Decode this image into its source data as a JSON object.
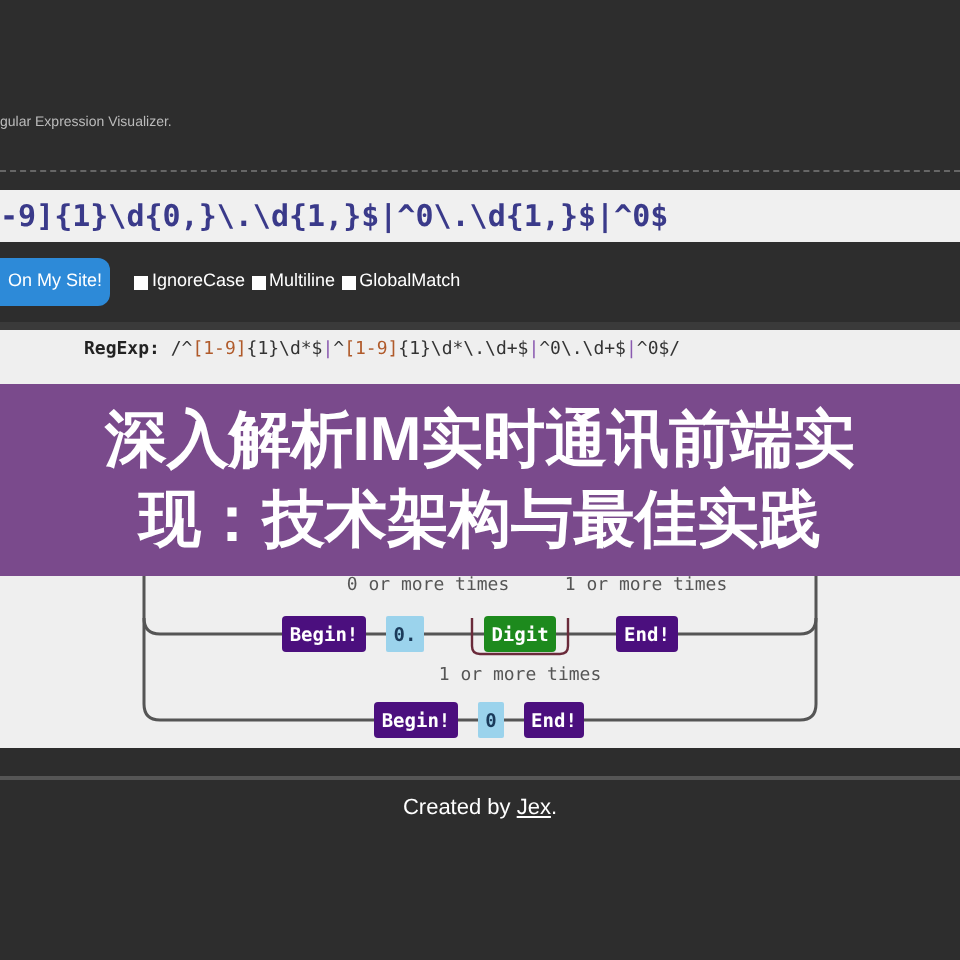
{
  "header": {
    "subtitle": "gular Expression Visualizer."
  },
  "input": {
    "value": "-9]{1}\\d{0,}\\.\\d{1,}$|^0\\.\\d{1,}$|^0$"
  },
  "embed_button": {
    "label": "On My Site!"
  },
  "options": [
    {
      "label": "IgnoreCase",
      "checked": false
    },
    {
      "label": "Multiline",
      "checked": false
    },
    {
      "label": "GlobalMatch",
      "checked": false
    }
  ],
  "regexp": {
    "label": "RegExp:",
    "parts": [
      {
        "text": "/^",
        "kind": "plain"
      },
      {
        "text": "[1-9]",
        "kind": "class"
      },
      {
        "text": "{1}\\d*$",
        "kind": "plain"
      },
      {
        "text": "|",
        "kind": "alt"
      },
      {
        "text": "^",
        "kind": "plain"
      },
      {
        "text": "[1-9]",
        "kind": "class"
      },
      {
        "text": "{1}\\d*\\.\\d+$",
        "kind": "plain"
      },
      {
        "text": "|",
        "kind": "alt"
      },
      {
        "text": "^0\\.\\d+$",
        "kind": "plain"
      },
      {
        "text": "|",
        "kind": "alt"
      },
      {
        "text": "^0$/",
        "kind": "plain"
      }
    ]
  },
  "diagram": {
    "branches": [
      {
        "repeats": [
          "0 or more times",
          "1 or more times"
        ]
      },
      {
        "nodes": [
          {
            "text": "Begin!",
            "kind": "box",
            "color": "#4b0f7e"
          },
          {
            "text": "0.",
            "kind": "literal",
            "color": "#9bd3ec"
          },
          {
            "text": "Digit",
            "kind": "box",
            "color": "#1d8a1d"
          },
          {
            "text": "End!",
            "kind": "box",
            "color": "#4b0f7e"
          }
        ],
        "repeats": [
          "1 or more times"
        ]
      },
      {
        "nodes": [
          {
            "text": "Begin!",
            "kind": "box",
            "color": "#4b0f7e"
          },
          {
            "text": "0",
            "kind": "literal",
            "color": "#9bd3ec"
          },
          {
            "text": "End!",
            "kind": "box",
            "color": "#4b0f7e"
          }
        ]
      }
    ]
  },
  "banner": {
    "title": "深入解析IM实时通讯前端实现：技术架构与最佳实践"
  },
  "footer": {
    "text": "Created by ",
    "link": "Jex",
    "end": "."
  }
}
